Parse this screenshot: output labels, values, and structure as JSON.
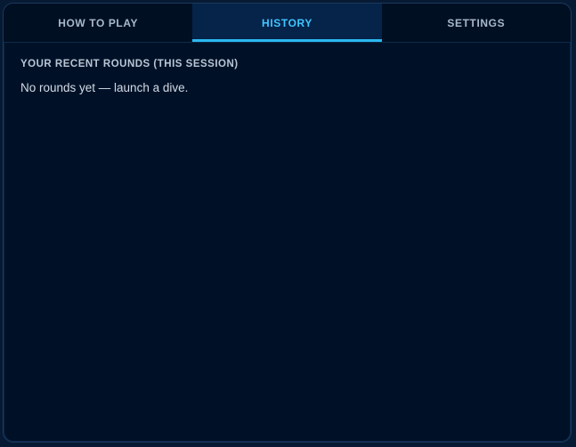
{
  "tabs": [
    {
      "label": "HOW TO PLAY",
      "active": false
    },
    {
      "label": "HISTORY",
      "active": true
    },
    {
      "label": "SETTINGS",
      "active": false
    }
  ],
  "history": {
    "heading": "YOUR RECENT ROUNDS (THIS SESSION)",
    "empty_message": "No rounds yet — launch a dive."
  },
  "colors": {
    "accent": "#2bb8f0",
    "panel_background": "#001127",
    "active_tab_background": "#06234a"
  }
}
